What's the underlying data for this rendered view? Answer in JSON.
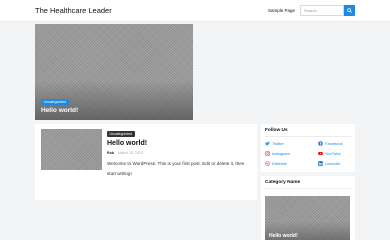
{
  "header": {
    "site_title": "The Healthcare Leader",
    "nav": [
      {
        "label": "Sample Page"
      }
    ],
    "search": {
      "placeholder": "Search",
      "value": ""
    }
  },
  "hero": {
    "category": "Uncategorized",
    "title": "Hello world!"
  },
  "post": {
    "category": "Uncategorized",
    "title": "Hello world!",
    "author": "Rob",
    "date": "March 15, 2023",
    "excerpt": "Welcome to WordPress. This is your first post. Edit or delete it, then start writing!"
  },
  "sidebar": {
    "follow": {
      "title": "Follow Us",
      "links": [
        {
          "label": "Twitter",
          "icon": "twitter-icon",
          "color": "#1DA1F2"
        },
        {
          "label": "Facebook",
          "icon": "facebook-icon",
          "color": "#1877F2"
        },
        {
          "label": "Instagram",
          "icon": "instagram-icon",
          "color": "#E1306C"
        },
        {
          "label": "YouTube",
          "icon": "youtube-icon",
          "color": "#FF0000"
        },
        {
          "label": "Dribbble",
          "icon": "dribbble-icon",
          "color": "#EA4C89"
        },
        {
          "label": "LinkedIn",
          "icon": "linkedin-icon",
          "color": "#0A66C2"
        }
      ]
    },
    "category": {
      "title": "Category Name",
      "post_title": "Hello world!"
    }
  },
  "colors": {
    "accent": "#1e88e5",
    "background": "#f3f4f6"
  }
}
